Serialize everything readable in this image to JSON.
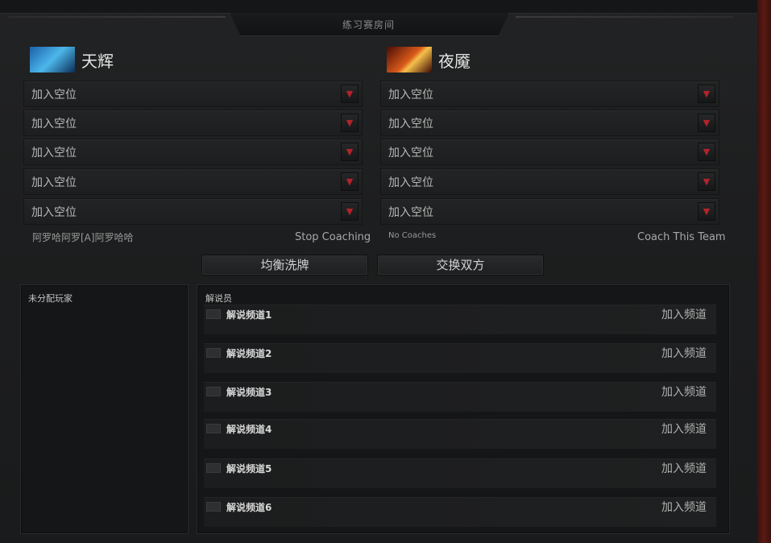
{
  "header": {
    "title": "练习赛房间"
  },
  "radiant": {
    "name": "天辉",
    "slots": [
      "加入空位",
      "加入空位",
      "加入空位",
      "加入空位",
      "加入空位"
    ],
    "coach_player": "阿罗哈阿罗[A]阿罗哈哈",
    "coach_action": "Stop Coaching"
  },
  "dire": {
    "name": "夜魇",
    "slots": [
      "加入空位",
      "加入空位",
      "加入空位",
      "加入空位",
      "加入空位"
    ],
    "coach_status": "No Coaches",
    "coach_action": "Coach This Team"
  },
  "actions": {
    "shuffle": "均衡洗牌",
    "swap": "交换双方"
  },
  "unassigned": {
    "label": "未分配玩家"
  },
  "broadcasters": {
    "label": "解说员",
    "channels": [
      {
        "name": "解说频道1",
        "join": "加入频道"
      },
      {
        "name": "解说频道2",
        "join": "加入频道"
      },
      {
        "name": "解说频道3",
        "join": "加入频道"
      },
      {
        "name": "解说频道4",
        "join": "加入频道"
      },
      {
        "name": "解说频道5",
        "join": "加入频道"
      },
      {
        "name": "解说频道6",
        "join": "加入频道"
      }
    ]
  },
  "colors": {
    "dropdown_arrow": "#b2242a",
    "background": "#1b1c1d"
  },
  "icons": {
    "radiant": "radiant-team-icon",
    "dire": "dire-team-icon",
    "dropdown": "chevron-down-icon"
  }
}
